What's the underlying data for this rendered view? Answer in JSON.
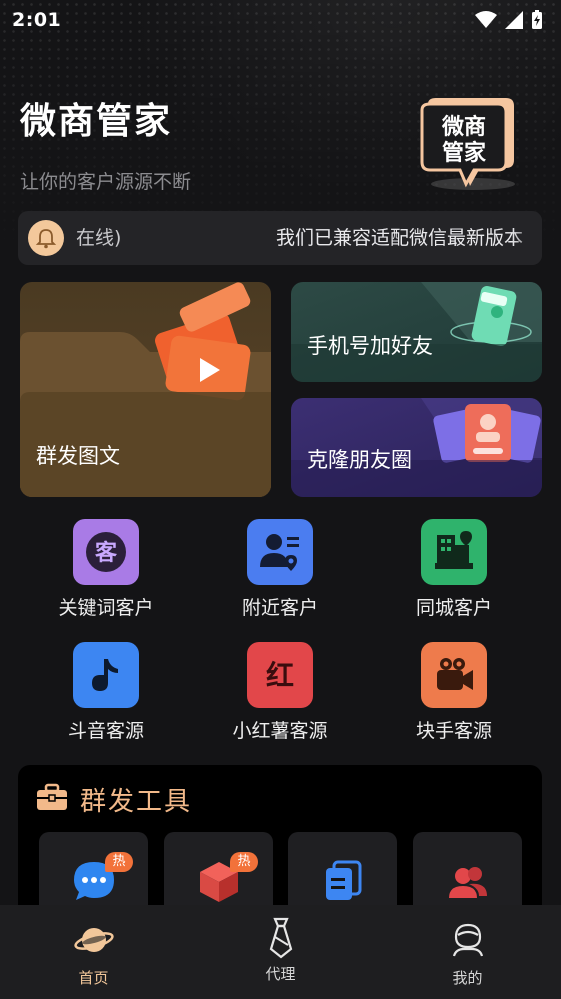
{
  "status_bar": {
    "time": "2:01"
  },
  "header": {
    "title": "微商管家",
    "subtitle": "让你的客户源源不断",
    "logo_text_line1": "微商",
    "logo_text_line2": "管家"
  },
  "notice": {
    "left_text": "在线)",
    "right_text": "我们已兼容适配微信最新版本"
  },
  "feature_cards": [
    {
      "label": "群发图文",
      "icon": "video-folder-icon"
    },
    {
      "label": "手机号加好友",
      "icon": "phone-icon"
    },
    {
      "label": "克隆朋友圈",
      "icon": "profile-cards-icon"
    }
  ],
  "grid": [
    {
      "label": "关键词客户",
      "icon": "keyword-customer-icon",
      "glyph": "客",
      "color": "#a97be6"
    },
    {
      "label": "附近客户",
      "icon": "nearby-customer-icon",
      "color": "#4b7df0"
    },
    {
      "label": "同城客户",
      "icon": "same-city-icon",
      "color": "#2fb36c"
    },
    {
      "label": "斗音客源",
      "icon": "music-note-icon",
      "color": "#3d86f2"
    },
    {
      "label": "小红薯客源",
      "icon": "red-icon",
      "glyph": "红",
      "color": "#e2474a"
    },
    {
      "label": "块手客源",
      "icon": "camera-icon",
      "color": "#ee7b4c"
    }
  ],
  "tools": {
    "title": "群发工具",
    "items": [
      {
        "icon": "chat-bubble-icon",
        "badge": "热"
      },
      {
        "icon": "cube-icon",
        "badge": "热"
      },
      {
        "icon": "copy-icon",
        "badge": ""
      },
      {
        "icon": "group-icon",
        "badge": ""
      }
    ]
  },
  "bottom_nav": [
    {
      "label": "首页",
      "icon": "planet-icon",
      "active": true
    },
    {
      "label": "代理",
      "icon": "tie-icon",
      "active": false
    },
    {
      "label": "我的",
      "icon": "user-icon",
      "active": false
    }
  ],
  "colors": {
    "accent": "#f2c79a",
    "background": "#141416"
  }
}
